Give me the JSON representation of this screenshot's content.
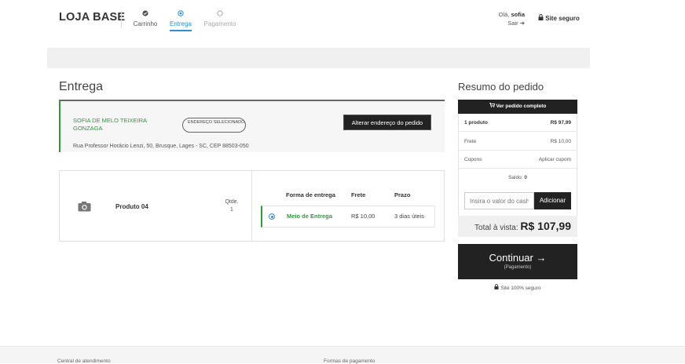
{
  "header": {
    "logo": "LOJA BASE",
    "steps": [
      {
        "label": "Carrinho",
        "state": "done",
        "icon": "check-circle-icon"
      },
      {
        "label": "Entrega",
        "state": "active",
        "icon": "radio-dot-icon"
      },
      {
        "label": "Pagamento",
        "state": "pending",
        "icon": "empty-circle-icon"
      }
    ],
    "user_greeting": "Olá,",
    "user_name": "sofia",
    "logout_label": "Sair",
    "secure_label": "Site seguro"
  },
  "main": {
    "title": "Entrega",
    "address": {
      "name": "SOFIA DE MELO TEIXEIRA GONZAGA",
      "badge": "ENDEREÇO SELECIONADO",
      "change_button": "Alterar endereço do pedido",
      "line": "Rua Professor Horácio Lenzi, 50, Brusque, Lages - SC, CEP 88503-050"
    },
    "product": {
      "name": "Produto 04",
      "qty_label": "Qtde.",
      "qty": "1"
    },
    "shipping": {
      "headers": {
        "method": "Forma de entrega",
        "price": "Frete",
        "deadline": "Prazo"
      },
      "option": {
        "name": "Meio de Entrega",
        "price": "R$ 10,00",
        "deadline": "3 dias úteis",
        "selected": true
      }
    }
  },
  "summary": {
    "title": "Resumo do pedido",
    "view_full": "Ver pedido completo",
    "rows": [
      {
        "label": "1 produto",
        "value": "R$ 97,99"
      },
      {
        "label": "Frete",
        "value": "R$ 10,00"
      },
      {
        "label": "Cupons",
        "value": "Aplicar cupom"
      }
    ],
    "saldo_label": "Saldo:",
    "saldo_value": "0",
    "cash_placeholder": "Insira o valor do cash",
    "cash_button": "Adicionar",
    "total_label": "Total à vista:",
    "total_value": "R$ 107,99",
    "continue_label": "Continuar →",
    "continue_sub": "(Pagamento)",
    "secure_note": "Site 100% seguro"
  },
  "footer": {
    "col1": "Central de atendimento",
    "col2": "Formas de pagamento"
  },
  "colors": {
    "accent_blue": "#2e8fd1",
    "success_green": "#2d9b3c",
    "dark_button": "#222222"
  }
}
